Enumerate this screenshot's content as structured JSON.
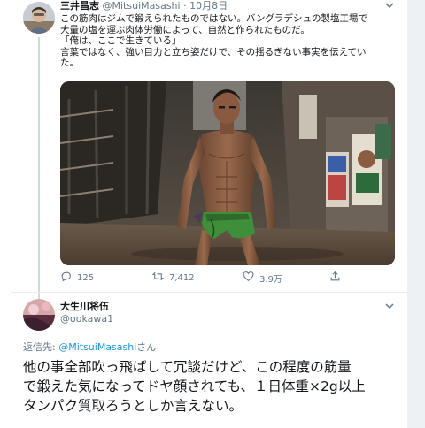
{
  "tweet1": {
    "display_name": "三井昌志",
    "handle": "@MitsuiMasashi",
    "separator": "·",
    "date": "10月8日",
    "lines": [
      "この筋肉はジムで鍛えられたものではない。バングラデシュの製塩工場で",
      "大量の塩を運ぶ肉体労働によって、自然と作られたものだ。",
      "「俺は、ここで生きている」",
      "言葉ではなく、強い目力と立ち姿だけで、その揺るぎない事実を伝えてい",
      "た。"
    ],
    "reply_count": "125",
    "retweet_count": "7,412",
    "like_count": "3.9万"
  },
  "tweet2": {
    "display_name": "大生川将伍",
    "handle": "@ookawa1",
    "reply_prefix": "返信先: ",
    "reply_handle": "@MitsuiMasashi",
    "reply_suffix": "さん",
    "lines": [
      "他の事全部吹っ飛ばして冗談だけど、この程度の筋量",
      "で鍛えた気になってドヤ顔されても、１日体重×2g以上",
      "タンパク質取ろうとしか言えない。"
    ]
  },
  "colors": {
    "link": "#1b95e0",
    "muted": "#657786",
    "text": "#14171a",
    "green_cloth": "#3f8f3a"
  },
  "icons": {
    "reply": "reply-icon",
    "retweet": "retweet-icon",
    "like": "heart-icon",
    "share": "share-icon",
    "menu": "chevron-down-icon"
  }
}
